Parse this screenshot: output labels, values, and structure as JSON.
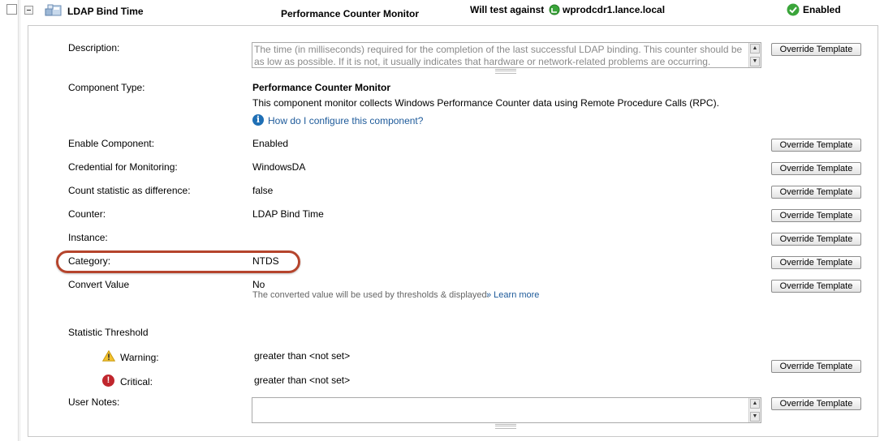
{
  "header": {
    "component_name": "LDAP Bind Time",
    "component_type": "Performance Counter Monitor",
    "will_test_label": "Will test against",
    "node_name": "wprodcdr1.lance.local",
    "status": "Enabled"
  },
  "fields": {
    "description": {
      "label": "Description:",
      "value": "The time (in milliseconds) required for the completion of the last successful LDAP binding. This counter should be as low as possible. If it is not, it usually indicates that hardware or network-related problems are occurring."
    },
    "component_type": {
      "label": "Component Type:",
      "title": "Performance Counter Monitor",
      "description": "This component monitor collects Windows Performance Counter data using Remote Procedure Calls (RPC).",
      "help_link": "How do I configure this component?"
    },
    "enable_component": {
      "label": "Enable Component:",
      "value": "Enabled"
    },
    "credential": {
      "label": "Credential for Monitoring:",
      "value": "WindowsDA"
    },
    "count_difference": {
      "label": "Count statistic as difference:",
      "value": "false"
    },
    "counter": {
      "label": "Counter:",
      "value": "LDAP Bind Time"
    },
    "instance": {
      "label": "Instance:",
      "value": ""
    },
    "category": {
      "label": "Category:",
      "value": "NTDS"
    },
    "convert_value": {
      "label": "Convert Value",
      "value": "No",
      "note": "The converted value will be used by thresholds & displayed.",
      "learn_more": "» Learn more"
    },
    "statistic_threshold": {
      "label": "Statistic Threshold",
      "warning_label": "Warning:",
      "warning_value": "greater than <not set>",
      "critical_label": "Critical:",
      "critical_value": "greater than <not set>"
    },
    "user_notes": {
      "label": "User Notes:",
      "value": ""
    }
  },
  "buttons": {
    "override_template": "Override Template"
  },
  "colors": {
    "highlight": "#b5442c",
    "link": "#1d5a9a",
    "enabled_green": "#3aa53a",
    "critical_red": "#c0262d",
    "warning_yellow": "#f2c12e"
  }
}
